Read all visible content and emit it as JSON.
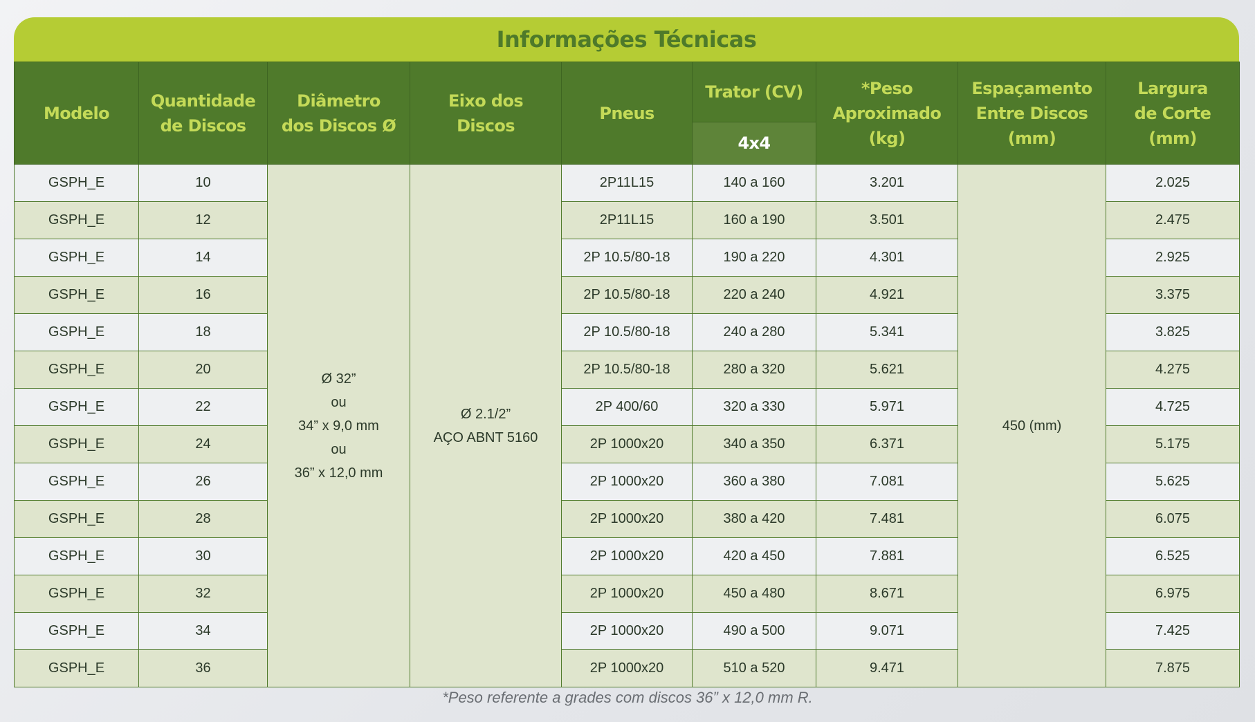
{
  "title": "Informações Técnicas",
  "headers": {
    "modelo": "Modelo",
    "quantidade": [
      "Quantidade",
      "de Discos"
    ],
    "diametro": [
      "Diâmetro",
      "dos Discos Ø"
    ],
    "eixo": [
      "Eixo dos",
      "Discos"
    ],
    "pneus": "Pneus",
    "trator": "Trator (CV)",
    "trator_sub": "4x4",
    "peso": [
      "*Peso",
      "Aproximado",
      "(kg)"
    ],
    "espacamento": [
      "Espaçamento",
      "Entre Discos",
      "(mm)"
    ],
    "largura": [
      "Largura",
      "de Corte",
      "(mm)"
    ]
  },
  "merged": {
    "diametro": [
      "Ø 32”",
      "ou",
      "34” x 9,0 mm",
      "ou",
      "36” x 12,0 mm"
    ],
    "eixo": [
      "Ø 2.1/2”",
      "AÇO ABNT 5160"
    ],
    "espacamento": "450 (mm)"
  },
  "rows": [
    {
      "modelo": "GSPH_E",
      "qtd": "10",
      "pneus": "2P11L15",
      "trator": "140 a 160",
      "peso": "3.201",
      "largura": "2.025"
    },
    {
      "modelo": "GSPH_E",
      "qtd": "12",
      "pneus": "2P11L15",
      "trator": "160 a 190",
      "peso": "3.501",
      "largura": "2.475"
    },
    {
      "modelo": "GSPH_E",
      "qtd": "14",
      "pneus": "2P 10.5/80-18",
      "trator": "190 a 220",
      "peso": "4.301",
      "largura": "2.925"
    },
    {
      "modelo": "GSPH_E",
      "qtd": "16",
      "pneus": "2P 10.5/80-18",
      "trator": "220 a 240",
      "peso": "4.921",
      "largura": "3.375"
    },
    {
      "modelo": "GSPH_E",
      "qtd": "18",
      "pneus": "2P 10.5/80-18",
      "trator": "240 a 280",
      "peso": "5.341",
      "largura": "3.825"
    },
    {
      "modelo": "GSPH_E",
      "qtd": "20",
      "pneus": "2P 10.5/80-18",
      "trator": "280 a 320",
      "peso": "5.621",
      "largura": "4.275"
    },
    {
      "modelo": "GSPH_E",
      "qtd": "22",
      "pneus": "2P 400/60",
      "trator": "320 a 330",
      "peso": "5.971",
      "largura": "4.725"
    },
    {
      "modelo": "GSPH_E",
      "qtd": "24",
      "pneus": "2P 1000x20",
      "trator": "340 a 350",
      "peso": "6.371",
      "largura": "5.175"
    },
    {
      "modelo": "GSPH_E",
      "qtd": "26",
      "pneus": "2P 1000x20",
      "trator": "360 a 380",
      "peso": "7.081",
      "largura": "5.625"
    },
    {
      "modelo": "GSPH_E",
      "qtd": "28",
      "pneus": "2P 1000x20",
      "trator": "380 a 420",
      "peso": "7.481",
      "largura": "6.075"
    },
    {
      "modelo": "GSPH_E",
      "qtd": "30",
      "pneus": "2P 1000x20",
      "trator": "420 a 450",
      "peso": "7.881",
      "largura": "6.525"
    },
    {
      "modelo": "GSPH_E",
      "qtd": "32",
      "pneus": "2P 1000x20",
      "trator": "450 a 480",
      "peso": "8.671",
      "largura": "6.975"
    },
    {
      "modelo": "GSPH_E",
      "qtd": "34",
      "pneus": "2P 1000x20",
      "trator": "490 a 500",
      "peso": "9.071",
      "largura": "7.425"
    },
    {
      "modelo": "GSPH_E",
      "qtd": "36",
      "pneus": "2P 1000x20",
      "trator": "510 a 520",
      "peso": "9.471",
      "largura": "7.875"
    }
  ],
  "footnote": "*Peso referente a grades com discos 36” x 12,0 mm R.",
  "colors": {
    "title_bar": "#b5cc34",
    "header_bg": "#4f7a2b",
    "header_text": "#c4da58",
    "row_light": "#eef0f2",
    "row_green": "#dfe5cd"
  }
}
